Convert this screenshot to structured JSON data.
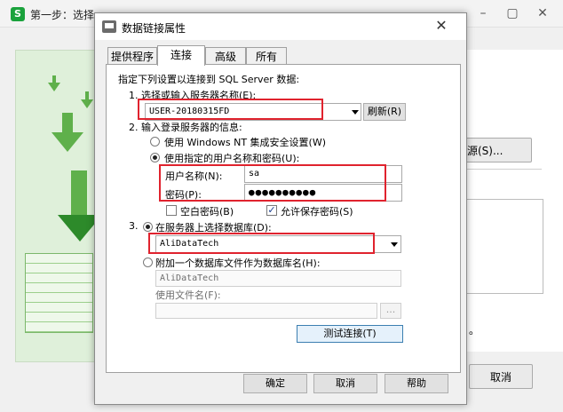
{
  "background_window": {
    "app_icon_letter": "S",
    "title": "第一步：选择",
    "data_source_button": "源(S)...",
    "status_text": "。",
    "cancel_button": "取消"
  },
  "dialog": {
    "title": "数据链接属性",
    "close_glyph": "✕",
    "tabs": [
      {
        "label": "提供程序",
        "active": false
      },
      {
        "label": "连接",
        "active": true
      },
      {
        "label": "高级",
        "active": false
      },
      {
        "label": "所有",
        "active": false
      }
    ],
    "intro": "指定下列设置以连接到 SQL Server 数据:",
    "step1": {
      "label": "1. 选择或输入服务器名称(E):",
      "server_value": "USER-20180315FD",
      "refresh_button": "刷新(R)"
    },
    "step2": {
      "label": "2. 输入登录服务器的信息:",
      "option_nt_security": "使用 Windows NT 集成安全设置(W)",
      "option_username_password": "使用指定的用户名称和密码(U):",
      "username_label": "用户名称(N):",
      "username_value": "sa",
      "password_label": "密码(P):",
      "password_value": "●●●●●●●●●●",
      "blank_password": "空白密码(B)",
      "blank_password_checked": false,
      "allow_save_password": "允许保存密码(S)",
      "allow_save_password_checked": true
    },
    "step3": {
      "number": "3.",
      "option_select_db": "在服务器上选择数据库(D):",
      "database_value": "AliDataTech",
      "option_attach_file": "附加一个数据库文件作为数据库名(H):",
      "attach_value": "AliDataTech",
      "use_filename_label": "使用文件名(F):",
      "filename_value": "",
      "browse_button": "..."
    },
    "test_connection_button": "测试连接(T)",
    "ok_button": "确定",
    "cancel_button": "取消",
    "help_button": "帮助"
  },
  "colors": {
    "highlight_box": "#e0232e",
    "illustration_green": "#5fb04b",
    "illustration_bg": "#dff0da"
  }
}
